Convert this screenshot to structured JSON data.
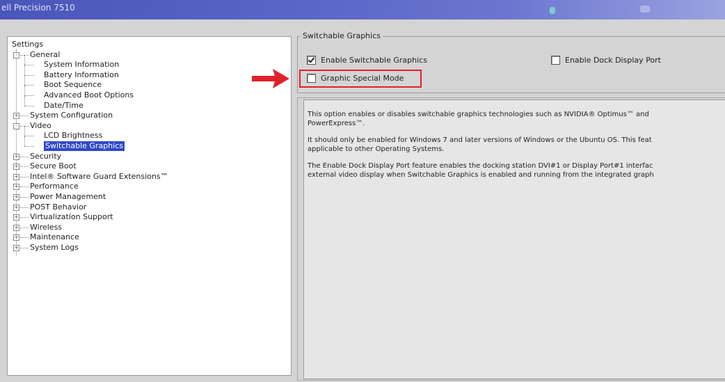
{
  "window": {
    "title": "ell Precision 7510"
  },
  "tree": {
    "root": "Settings",
    "items": [
      {
        "label": "General",
        "level": 1,
        "expander": "-"
      },
      {
        "label": "System Information",
        "level": 2
      },
      {
        "label": "Battery Information",
        "level": 2
      },
      {
        "label": "Boot Sequence",
        "level": 2
      },
      {
        "label": "Advanced Boot Options",
        "level": 2
      },
      {
        "label": "Date/Time",
        "level": 2
      },
      {
        "label": "System Configuration",
        "level": 1,
        "expander": "+"
      },
      {
        "label": "Video",
        "level": 1,
        "expander": "-"
      },
      {
        "label": "LCD Brightness",
        "level": 2
      },
      {
        "label": "Switchable Graphics",
        "level": 2,
        "selected": true
      },
      {
        "label": "Security",
        "level": 1,
        "expander": "+"
      },
      {
        "label": "Secure Boot",
        "level": 1,
        "expander": "+"
      },
      {
        "label": "Intel® Software Guard Extensions™",
        "level": 1,
        "expander": "+"
      },
      {
        "label": "Performance",
        "level": 1,
        "expander": "+"
      },
      {
        "label": "Power Management",
        "level": 1,
        "expander": "+"
      },
      {
        "label": "POST Behavior",
        "level": 1,
        "expander": "+"
      },
      {
        "label": "Virtualization Support",
        "level": 1,
        "expander": "+"
      },
      {
        "label": "Wireless",
        "level": 1,
        "expander": "+"
      },
      {
        "label": "Maintenance",
        "level": 1,
        "expander": "+"
      },
      {
        "label": "System Logs",
        "level": 1,
        "expander": "+"
      }
    ]
  },
  "panel": {
    "group_title": "Switchable Graphics",
    "options": {
      "enable_switchable": {
        "label": "Enable Switchable Graphics",
        "checked": true
      },
      "enable_dock": {
        "label": "Enable Dock Display Port",
        "checked": false
      },
      "special_mode": {
        "label": "Graphic Special Mode",
        "checked": false
      }
    },
    "description": {
      "p1_line1": "This option enables or disables switchable graphics technologies such as NVIDIA® Optimus™ and",
      "p1_line2": "PowerExpress™.",
      "p2_line1": "It should only be enabled for Windows 7 and later versions of Windows or the Ubuntu OS. This feat",
      "p2_line2": "applicable to other Operating Systems.",
      "p3_line1": "The Enable Dock Display Port feature enables the docking station DVI#1 or Display Port#1 interfac",
      "p3_line2": "external video display when Switchable Graphics is enabled and running from the integrated graph"
    }
  },
  "colors": {
    "highlight_border": "#e0202a",
    "arrow": "#e0202a",
    "selection": "#2f49c9",
    "titlebar": "#5c68c8"
  }
}
